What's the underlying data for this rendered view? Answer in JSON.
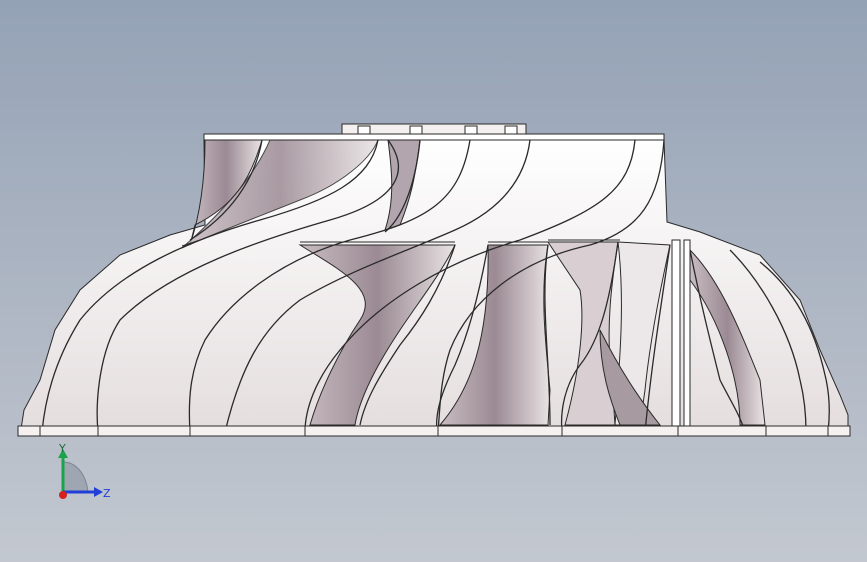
{
  "view": {
    "name": "impeller-side-view",
    "background_top": "#94a2b6",
    "background_bottom": "#c3c8d0"
  },
  "triad": {
    "y_label": "Y",
    "z_label": "Z",
    "y_color": "#1aa34a",
    "z_color": "#1f3fd8",
    "x_color": "#d62020"
  },
  "model": {
    "blade_color_light": "#f6f3f2",
    "blade_color_shadow": "#8e7f88",
    "edge_color": "#2a2a2a"
  }
}
